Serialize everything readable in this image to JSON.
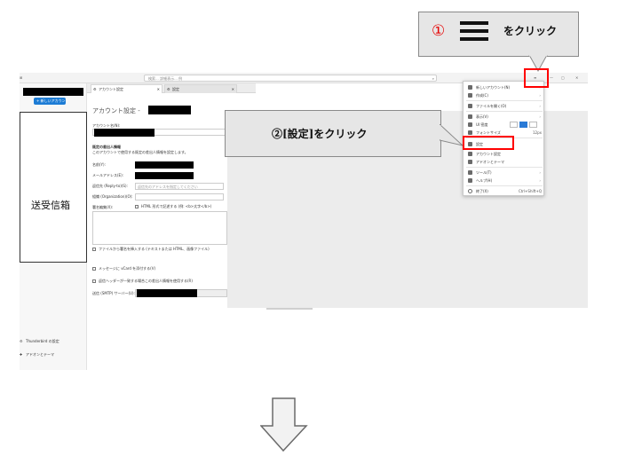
{
  "callout1": {
    "number": "①",
    "text": "をクリック"
  },
  "callout2": {
    "text": "②[設定]をクリック"
  },
  "titlebar": {
    "search_placeholder": "検索... 詳細表示... 例"
  },
  "sidebar": {
    "new_account_button": "+ 新しいアカウント",
    "inbox_label": "送受信箱",
    "footer_items": [
      "Thunderbird の設定",
      "アドオンとテーマ"
    ]
  },
  "tabs": [
    {
      "label": "アカウント設定"
    },
    {
      "label": "設定"
    }
  ],
  "account_settings": {
    "heading": "アカウント設定 -",
    "account_name_label": "アカウント名(N):",
    "identity_heading": "既定の差出人情報",
    "identity_note": "このアカウントで使用する既定の差出人情報を設定します。",
    "name_label": "名前(Y):",
    "email_label": "メールアドレス(E):",
    "reply_to_label": "返信先 (Reply-to)(S):",
    "reply_to_placeholder": "返信先のアドレスを指定してください",
    "org_label": "組織 (Organization)(O):",
    "signature_label": "署名編集(X):",
    "html_checkbox": "HTML 形式で記述する (例: <b>太字</b>)",
    "attach_signature": "ファイルから署名を挿入する (テキストまたは HTML、画像ファイル)",
    "vcard_checkbox": "メッセージに vCard を添付する(V)",
    "other_checkbox": "返信ヘッダーが一致する場合この差出人情報を使用する(R)",
    "smtp_label": "送信 (SMTP) サーバー(U):"
  },
  "menu": {
    "items": [
      {
        "label": "新しいアカウント(N)",
        "arrow": "›"
      },
      {
        "label": "作成(C)",
        "arrow": "›"
      },
      {
        "label": "ファイルを開く(O)",
        "arrow": "›"
      },
      {
        "label": "表示(V)",
        "arrow": "›"
      },
      {
        "label": "UI 密度"
      },
      {
        "label": "フォントサイズ",
        "shortcut": "12px"
      },
      {
        "label": "設定"
      },
      {
        "label": "アカウント設定"
      },
      {
        "label": "アドオンとテーマ"
      },
      {
        "label": "ツール(T)",
        "arrow": "›"
      },
      {
        "label": "ヘルプ(H)",
        "arrow": "›"
      },
      {
        "label": "終了(X)",
        "shortcut": "Ctrl+Shift+Q"
      }
    ]
  },
  "bottom_arrow": {
    "name": "down-arrow"
  }
}
